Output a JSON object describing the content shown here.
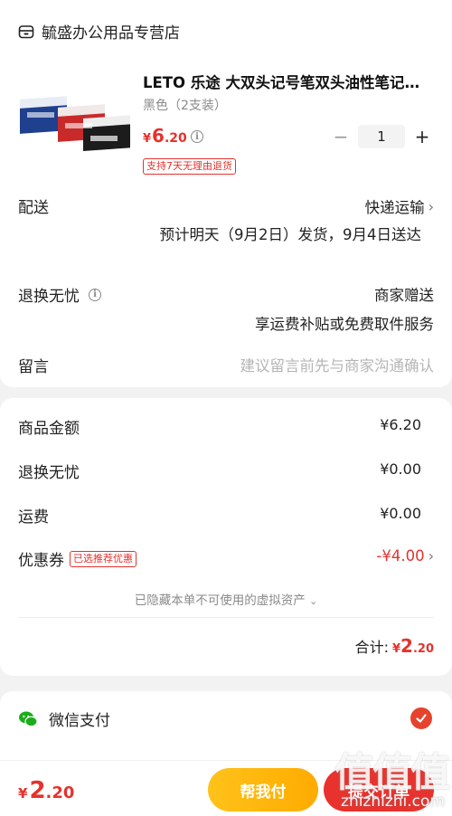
{
  "store": {
    "name": "毓盛办公用品专营店",
    "icon": "store-icon"
  },
  "product": {
    "title": "LETO 乐途 大双头记号笔双头油性笔记号笔速干防水不易褪色黑色",
    "variant": "黑色（2支装）",
    "price_symbol": "¥",
    "price_int": "6",
    "price_dec": ".20",
    "quantity": "1",
    "minus": "−",
    "plus": "+",
    "return_tag": "支持7天无理由退货"
  },
  "shipping": {
    "label": "配送",
    "method": "快递运输",
    "estimate": "预计明天（9月2日）发货，9月4日送达"
  },
  "worry_free": {
    "label": "退换无忧",
    "value": "商家赠送",
    "detail": "享运费补贴或免费取件服务"
  },
  "message": {
    "label": "留言",
    "placeholder": "建议留言前先与商家沟通确认"
  },
  "summary": {
    "rows": [
      {
        "label": "商品金额",
        "value": "¥6.20"
      },
      {
        "label": "退换无忧",
        "value": "¥0.00"
      },
      {
        "label": "运费",
        "value": "¥0.00"
      }
    ],
    "coupon_label": "优惠券",
    "coupon_tag": "已选推荐优惠",
    "coupon_value": "-¥4.00",
    "hidden_note": "已隐藏本单不可使用的虚拟资产",
    "total_label": "合计:",
    "total_symbol": "¥",
    "total_int": "2",
    "total_dec": ".20"
  },
  "payment": {
    "method": "微信支付",
    "selected": true
  },
  "bottom": {
    "price_symbol": "¥",
    "price_int": "2",
    "price_dec": ".20",
    "help_pay": "帮我付",
    "pay": "提交订单"
  },
  "watermark": {
    "glyphs": "值值值",
    "url": "zhizhizhi.com"
  },
  "colors": {
    "accent": "#e5322d",
    "help_button": "#ffb300",
    "wechat": "#1aad19"
  }
}
